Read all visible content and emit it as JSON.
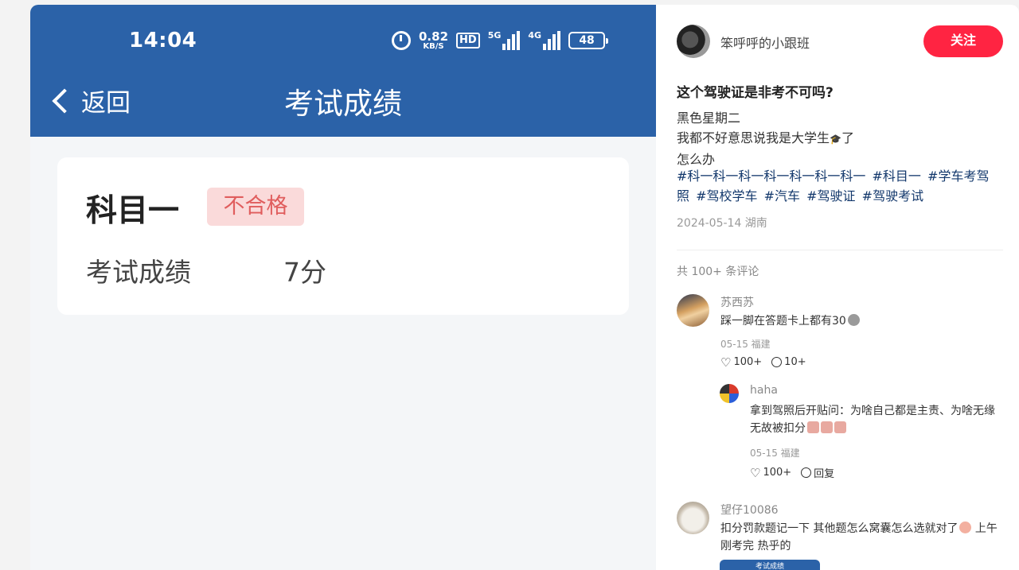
{
  "phone": {
    "status": {
      "time": "14:04",
      "speed_value": "0.82",
      "speed_unit": "KB/S",
      "hd": "HD",
      "net1": "5G",
      "net2": "4G",
      "battery": "48"
    },
    "nav": {
      "back_label": "返回",
      "title": "考试成绩"
    },
    "card": {
      "subject": "科目一",
      "badge": "不合格",
      "score_label": "考试成绩",
      "score_value": "7分"
    },
    "colors": {
      "header": "#2b62a8",
      "badge_bg": "#fadada",
      "badge_text": "#e05d5d"
    }
  },
  "post": {
    "author": "笨呼呼的小跟班",
    "follow_label": "关注",
    "title": "这个驾驶证是非考不可吗?",
    "lines": [
      "黑色星期二",
      "我都不好意思说我是大学生",
      "了",
      "怎么办"
    ],
    "tags": [
      "#科一科一科一科一科一科一科一",
      "#科目一",
      "#学车考驾照",
      "#驾校学车",
      "#汽车",
      "#驾驶证",
      "#驾驶考试"
    ],
    "date_location": "2024-05-14 湖南",
    "comment_count": "共 100+ 条评论",
    "accent": "#ff2442"
  },
  "comments": [
    {
      "name": "苏西苏",
      "text": "踩一脚在答题卡上都有30",
      "meta": "05-15 福建",
      "likes": "100+",
      "replies": "10+"
    },
    {
      "name": "望仔10086",
      "text": "扣分罚款题记一下 其他题怎么窝囊怎么选就对了",
      "text2": "上午刚考完 热乎的"
    }
  ],
  "reply": {
    "name": "haha",
    "text": "拿到驾照后开贴问：为啥自己都是主责、为啥无缘无故被扣分",
    "meta": "05-15 福建",
    "likes": "100+",
    "reply_label": "回复"
  },
  "thumbnail_title": "考试成绩"
}
